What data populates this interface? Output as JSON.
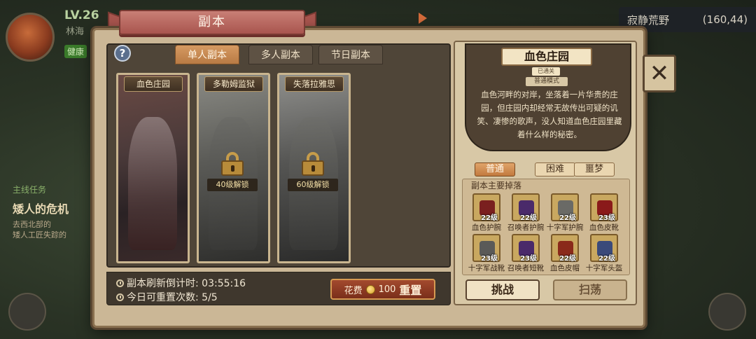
{
  "background": {
    "level": "LV.26",
    "player_name": "林海",
    "health_tag": "健康",
    "quest_header": "主线任务",
    "quest_title": "矮人的危机",
    "quest_line_1": "去西北部的",
    "quest_line_2": "矮人工匠失踪的",
    "location_name": "寂静荒野",
    "location_coords": "(160,44)"
  },
  "modal": {
    "title": "副本",
    "help_label": "?",
    "tabs": [
      {
        "label": "单人副本",
        "active": true
      },
      {
        "label": "多人副本",
        "active": false
      },
      {
        "label": "节日副本",
        "active": false
      }
    ],
    "dungeons": [
      {
        "name": "血色庄园",
        "locked": false,
        "unlock": ""
      },
      {
        "name": "多勒姆监狱",
        "locked": true,
        "unlock": "40级解锁"
      },
      {
        "name": "失落拉雅思",
        "locked": true,
        "unlock": "60级解锁"
      }
    ],
    "refresh_label": "副本刷新倒计时: 03:55:16",
    "resets_label": "今日可重置次数: 5/5",
    "reset_button": {
      "cost_prefix": "花费",
      "cost": "100",
      "action": "重置"
    },
    "close_label": "✕"
  },
  "detail": {
    "name": "血色庄园",
    "cleared_badge": "已通关",
    "mode_badge": "普通模式",
    "description": "血色河畔的对岸，坐落着一片华贵的庄园，但庄园内却经常无故传出可疑的讥笑、凄惨的歌声，没人知道血色庄园里藏着什么样的秘密。",
    "difficulties": [
      {
        "label": "普通",
        "active": true
      },
      {
        "label": "困难",
        "active": false
      },
      {
        "label": "噩梦",
        "active": false
      }
    ],
    "drops_title": "副本主要掉落",
    "drops": [
      {
        "name": "血色护腕",
        "level": "22级",
        "color": "#7a1f1f"
      },
      {
        "name": "召唤者护腕",
        "level": "22级",
        "color": "#4a2a6a"
      },
      {
        "name": "十字军护腕",
        "level": "22级",
        "color": "#6a6a66"
      },
      {
        "name": "血色皮靴",
        "level": "23级",
        "color": "#8a1a1a"
      },
      {
        "name": "十字军战靴",
        "level": "23级",
        "color": "#5a5a58"
      },
      {
        "name": "召唤者短靴",
        "level": "23级",
        "color": "#4a2a6a"
      },
      {
        "name": "血色皮帽",
        "level": "22级",
        "color": "#8a2a1a"
      },
      {
        "name": "十字军头盔",
        "level": "22级",
        "color": "#3a4a7a"
      }
    ],
    "challenge_label": "挑战",
    "sweep_label": "扫荡"
  }
}
